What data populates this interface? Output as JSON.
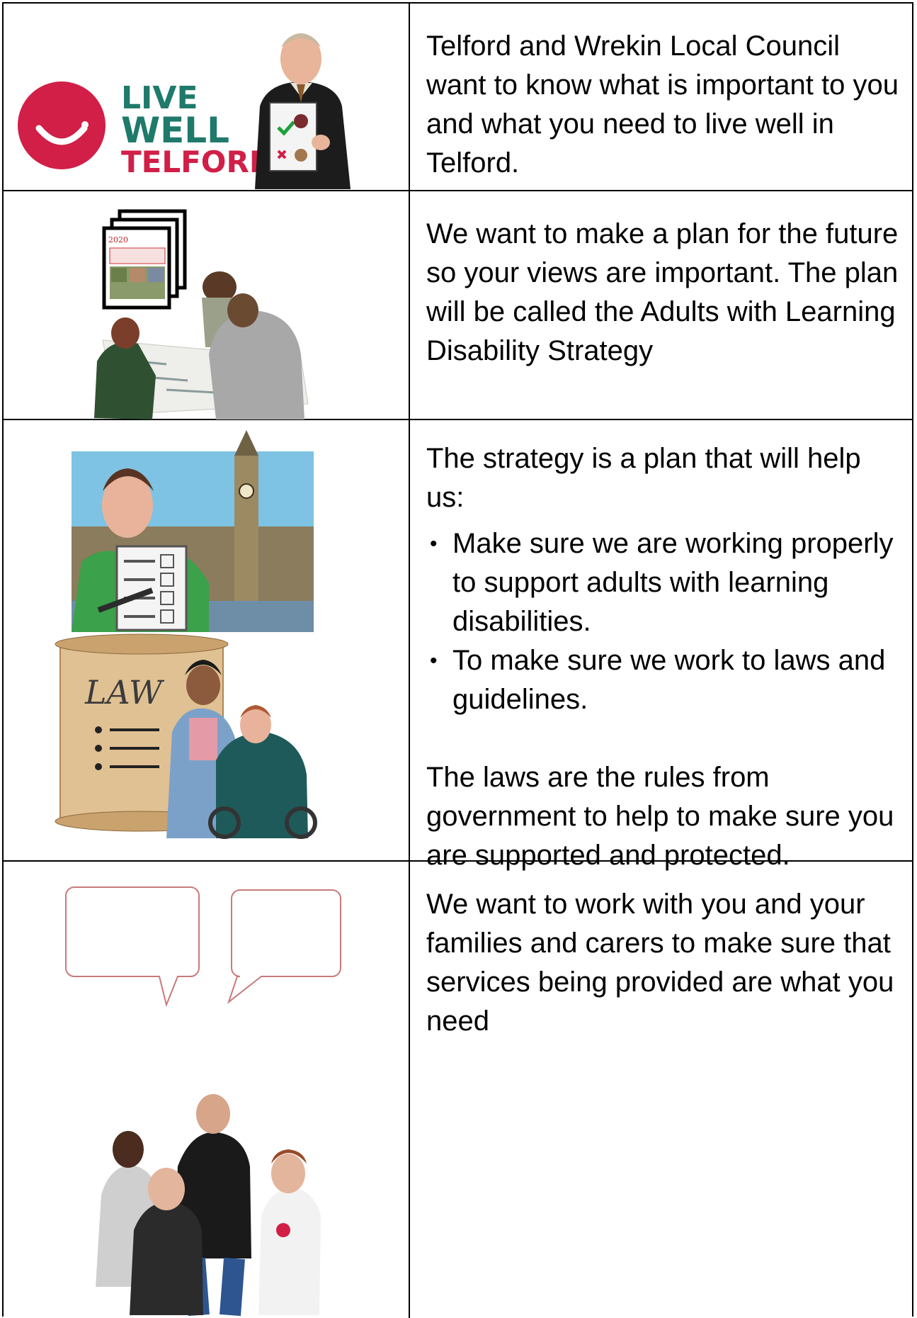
{
  "rows": [
    {
      "text": "Telford and Wrekin Local Council want to know what is important to you and what you need to live well in Telford.",
      "logo": {
        "line1": "LIVE",
        "line2": "WELL",
        "line3": "TELFORD",
        "icon": "smile-icon",
        "brand_color": "#d11f47",
        "text_color": "#1f7a6b"
      },
      "image": "man-with-clipboard-picture"
    },
    {
      "text": "We want to make a plan for the future so your views are important. The plan will be called the Adults with Learning Disability Strategy",
      "image": "people-planning-with-documents-picture",
      "doc_label": "2020"
    },
    {
      "intro": "The strategy is a plan that will help us:",
      "bullets": [
        "Make sure we are working properly to support adults with learning disabilities.",
        "To make sure we work to laws and guidelines."
      ],
      "outro": "The laws are the rules from government to help to make sure you are supported and protected.",
      "image_top": "woman-with-checklist-at-parliament-picture",
      "image_bottom": "law-scroll-and-carer-picture",
      "scroll_label": "LAW"
    },
    {
      "text": "We want to work with you and your families and carers to make sure that services being provided are what you need",
      "image": "group-conversation-with-speech-bubbles-picture"
    }
  ]
}
